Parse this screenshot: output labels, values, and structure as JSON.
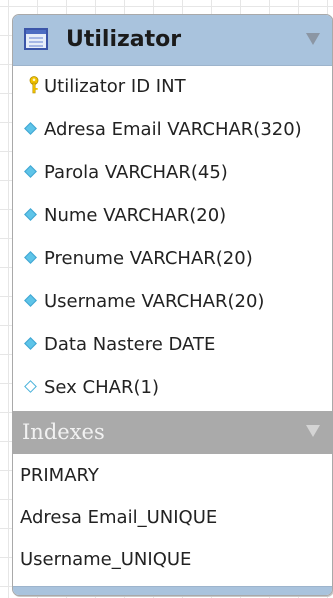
{
  "table": {
    "title": "Utilizator",
    "columns": [
      {
        "label": "Utilizator ID INT",
        "icon": "primary-key-icon"
      },
      {
        "label": "Adresa Email VARCHAR(320)",
        "icon": "not-null-column-icon"
      },
      {
        "label": "Parola VARCHAR(45)",
        "icon": "not-null-column-icon"
      },
      {
        "label": "Nume VARCHAR(20)",
        "icon": "not-null-column-icon"
      },
      {
        "label": "Prenume VARCHAR(20)",
        "icon": "not-null-column-icon"
      },
      {
        "label": "Username VARCHAR(20)",
        "icon": "not-null-column-icon"
      },
      {
        "label": "Data Nastere DATE",
        "icon": "not-null-column-icon"
      },
      {
        "label": "Sex CHAR(1)",
        "icon": "nullable-column-icon"
      }
    ],
    "indexes_label": "Indexes",
    "indexes": [
      "PRIMARY",
      "Adresa Email_UNIQUE",
      "Username_UNIQUE"
    ]
  },
  "colors": {
    "header": "#a9c3dd",
    "indexes_header": "#aaaaaa",
    "key": "#f2c200",
    "column_diamond": "#5ec4e8"
  }
}
